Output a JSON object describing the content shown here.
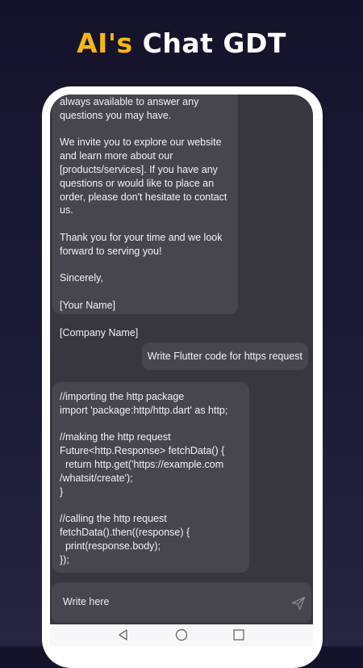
{
  "headline": {
    "accent": "AI's",
    "rest": "Chat GDT"
  },
  "conversation": {
    "bot_message_1": [
      "always available to answer any questions you may have.",
      "We invite you to explore our website and learn more about our [products/services]. If you have any questions or would like to place an order, please don't hesitate to contact us.",
      "Thank you for your time and we look forward to serving you!",
      "Sincerely,",
      "[Your Name]",
      "[Company Name]"
    ],
    "user_message_1": "Write Flutter code for https request",
    "bot_message_2": [
      "//importing the http package\nimport 'package:http/http.dart' as http;",
      "//making the http request\nFuture<http.Response> fetchData() {\n  return http.get('https://example.com\n/whatsit/create');\n}",
      "//calling the http request\nfetchData().then((response) {\n  print(response.body);\n});"
    ]
  },
  "input": {
    "placeholder": "Write here"
  },
  "icons": {
    "send": "send-icon",
    "back": "back-triangle-icon",
    "home": "home-circle-icon",
    "recents": "recents-square-icon"
  },
  "colors": {
    "accent": "#f6b716",
    "background": "#1c1b35",
    "screen": "#38373f",
    "bubble": "#47464f"
  }
}
